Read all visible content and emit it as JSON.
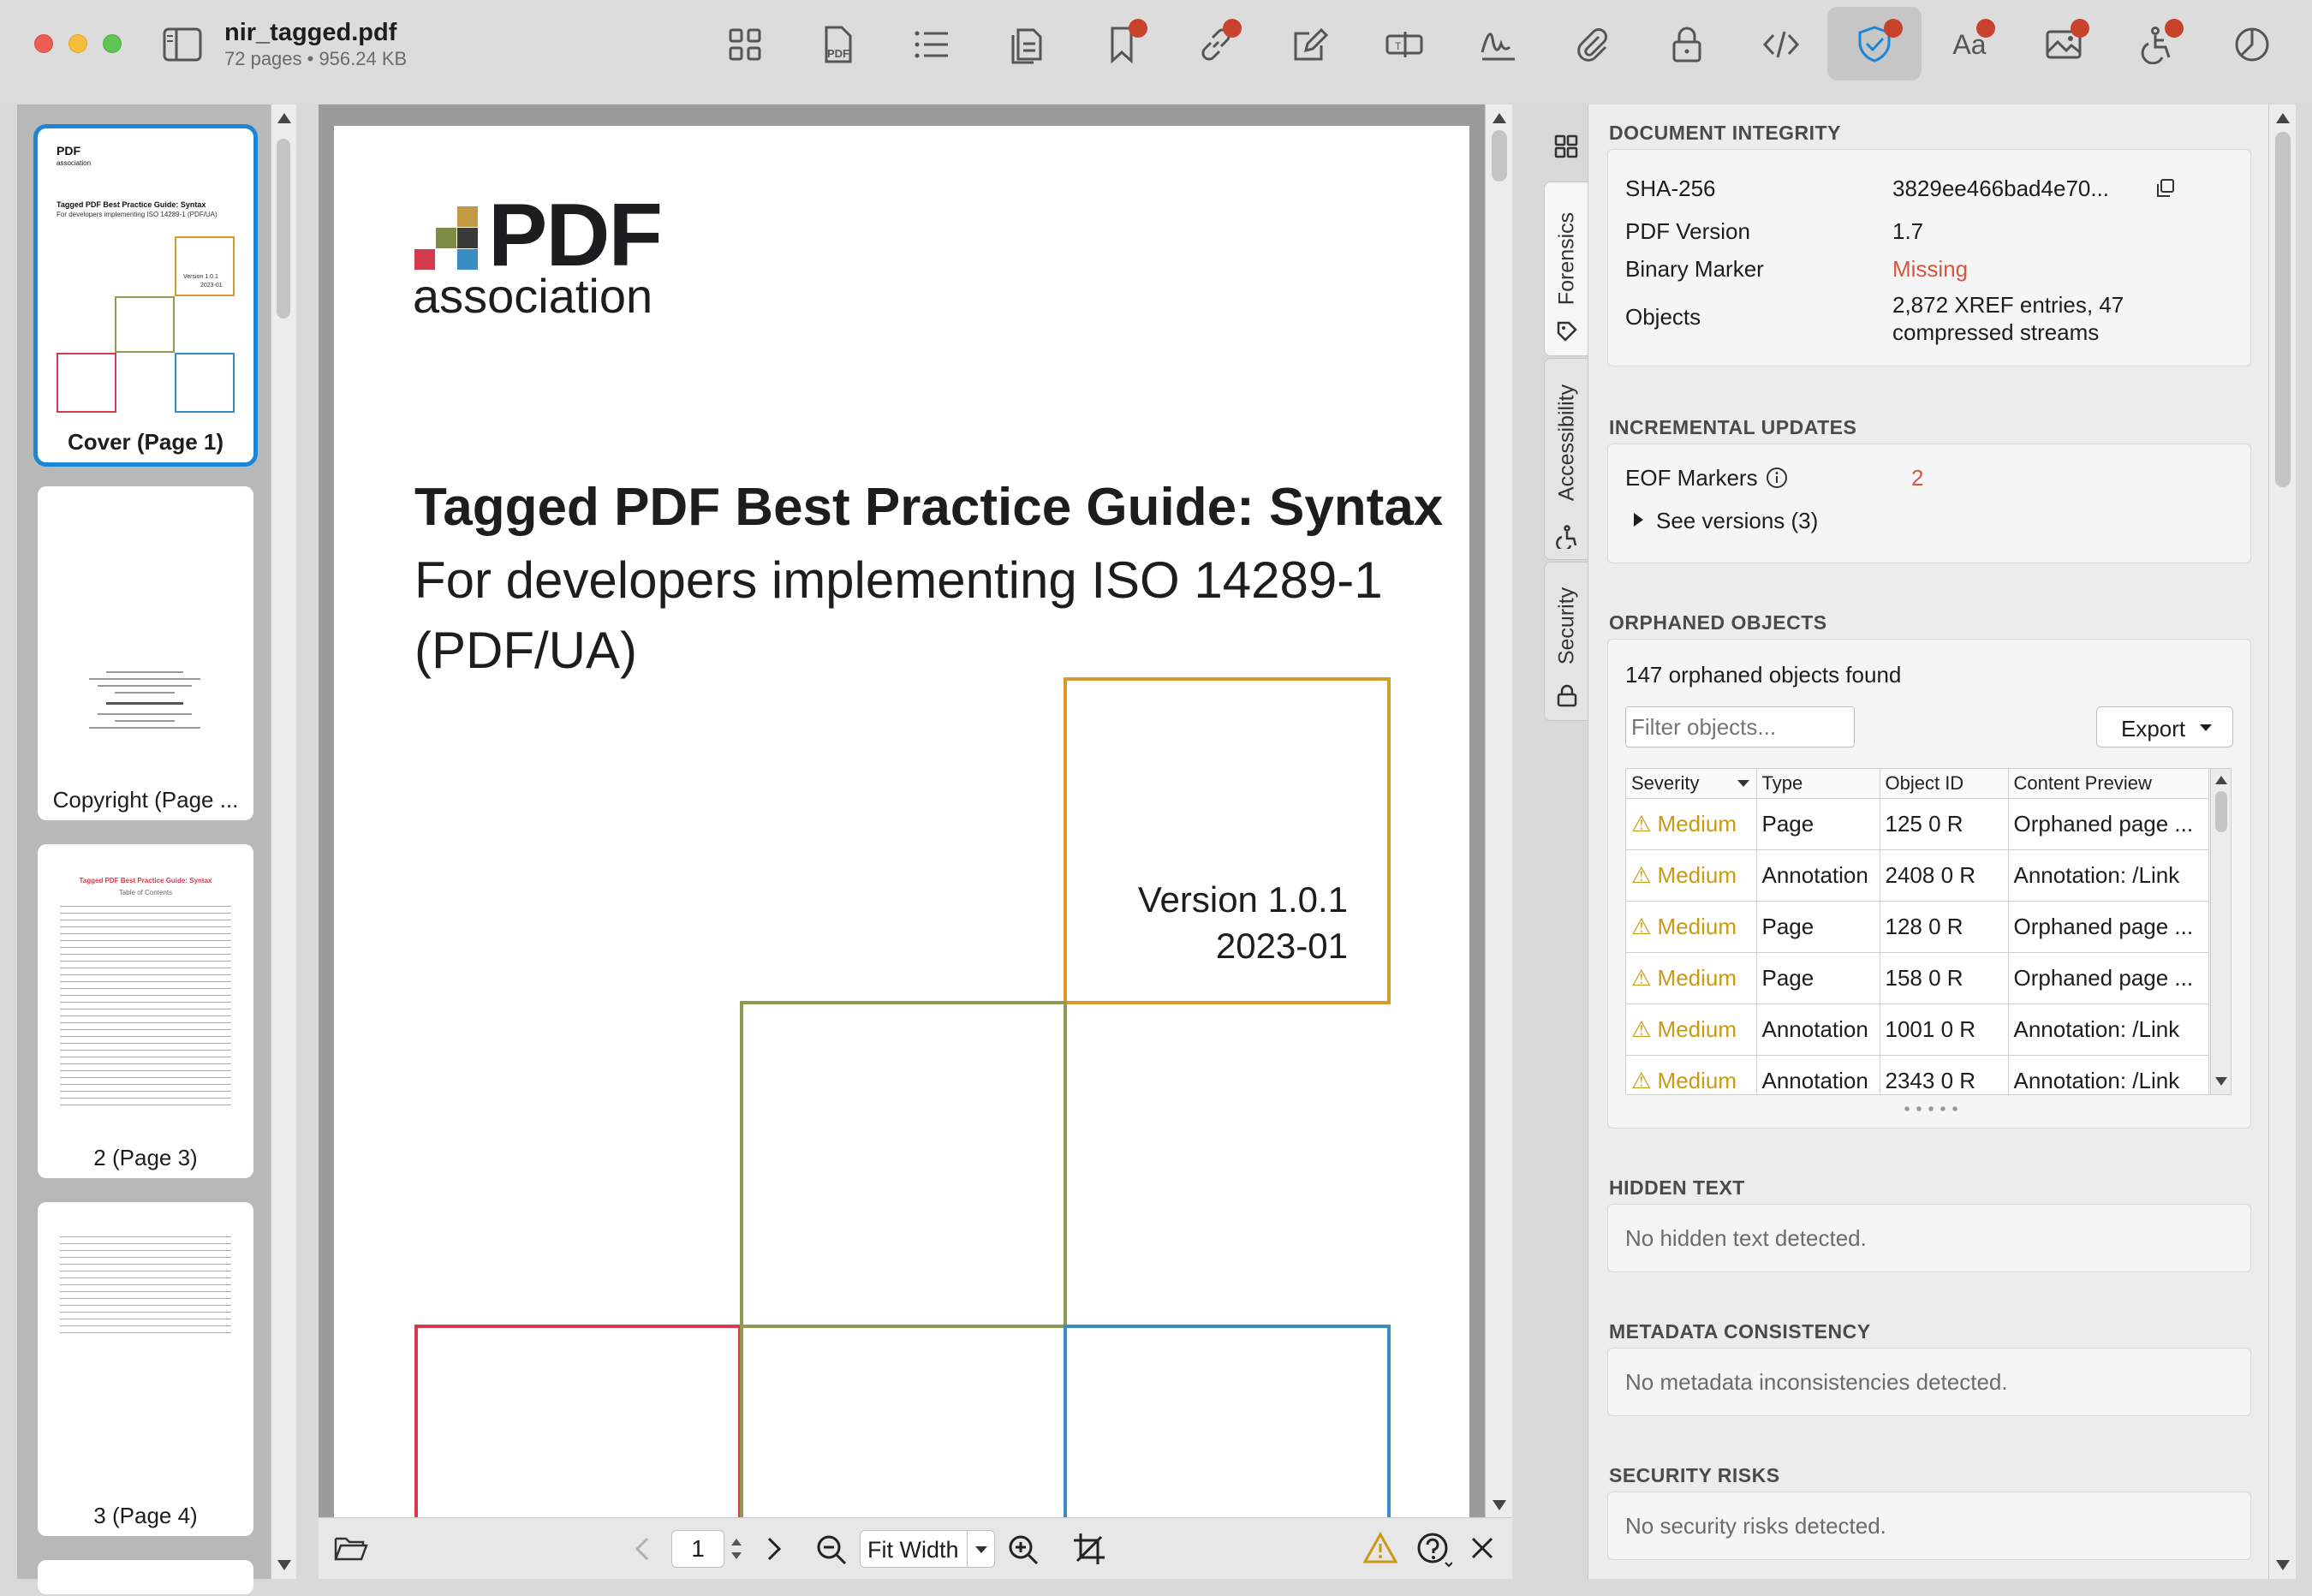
{
  "window": {
    "file_name": "nir_tagged.pdf",
    "file_info": "72 pages • 956.24 KB"
  },
  "toolbar": {
    "icons": [
      "grid-view-icon",
      "pdf-icon",
      "list-icon",
      "pages-icon",
      "bookmark-icon",
      "link-icon",
      "edit-icon",
      "form-field-icon",
      "signature-icon",
      "attachment-icon",
      "lock-icon",
      "code-icon",
      "shield-icon",
      "font-icon",
      "image-icon",
      "accessibility-icon",
      "pie-chart-icon"
    ],
    "pdf_label": "PDF",
    "font_label": "Aa",
    "accent": "#1a86d8",
    "badge_color": "#c8432b"
  },
  "thumbnails": [
    {
      "caption": "Cover (Page 1)",
      "selected": true
    },
    {
      "caption": "Copyright (Page ..."
    },
    {
      "caption": "2 (Page 3)"
    },
    {
      "caption": "3 (Page 4)"
    }
  ],
  "thumb_cover": {
    "logo": "PDF",
    "logo_sub": "association",
    "title": "Tagged PDF Best Practice Guide: Syntax",
    "subtitle": "For developers implementing ISO 14289-1 (PDF/UA)",
    "version": "Version 1.0.1",
    "date": "2023-01"
  },
  "thumb_toc": {
    "title": "Tagged PDF Best Practice Guide: Syntax",
    "subtitle": "Table of Contents"
  },
  "document": {
    "logo_text": "PDF",
    "logo_sub": "association",
    "title": "Tagged PDF Best Practice Guide: Syntax",
    "subtitle": "For developers implementing ISO 14289-1 (PDF/UA)",
    "version": "Version 1.0.1",
    "date": "2023-01",
    "colors": {
      "orange": "#d49a2a",
      "olive": "#8f9a52",
      "red": "#d63a4e",
      "blue": "#3a8cc5"
    }
  },
  "bottom_bar": {
    "page_number": "1",
    "zoom_mode": "Fit Width"
  },
  "side_tabs": [
    "Forensics",
    "Accessibility",
    "Security"
  ],
  "integrity": {
    "title": "DOCUMENT INTEGRITY",
    "sha_label": "SHA-256",
    "sha_value": "3829ee466bad4e70...",
    "version_label": "PDF Version",
    "version_value": "1.7",
    "binary_label": "Binary Marker",
    "binary_value": "Missing",
    "objects_label": "Objects",
    "objects_value_1": "2,872 XREF entries, 47",
    "objects_value_2": "compressed streams",
    "missing_color": "#d9553f"
  },
  "incremental": {
    "title": "INCREMENTAL UPDATES",
    "eof_label": "EOF Markers",
    "eof_value": "2",
    "see_versions": "See versions (3)"
  },
  "orphaned": {
    "title": "ORPHANED OBJECTS",
    "summary": "147 orphaned objects found",
    "filter_placeholder": "Filter objects...",
    "export_label": "Export",
    "columns": [
      "Severity",
      "Type",
      "Object ID",
      "Content Preview"
    ],
    "rows": [
      {
        "severity": "Medium",
        "type": "Page",
        "id": "125 0 R",
        "preview": "Orphaned page ..."
      },
      {
        "severity": "Medium",
        "type": "Annotation",
        "id": "2408 0 R",
        "preview": "Annotation: /Link"
      },
      {
        "severity": "Medium",
        "type": "Page",
        "id": "128 0 R",
        "preview": "Orphaned page ..."
      },
      {
        "severity": "Medium",
        "type": "Page",
        "id": "158 0 R",
        "preview": "Orphaned page ..."
      },
      {
        "severity": "Medium",
        "type": "Annotation",
        "id": "1001 0 R",
        "preview": "Annotation: /Link"
      },
      {
        "severity": "Medium",
        "type": "Annotation",
        "id": "2343 0 R",
        "preview": "Annotation: /Link"
      }
    ],
    "severity_color": "#c89a13"
  },
  "hidden_text": {
    "title": "HIDDEN TEXT",
    "message": "No hidden text detected."
  },
  "metadata": {
    "title": "METADATA CONSISTENCY",
    "message": "No metadata inconsistencies detected."
  },
  "security": {
    "title": "SECURITY RISKS",
    "message": "No security risks detected."
  }
}
